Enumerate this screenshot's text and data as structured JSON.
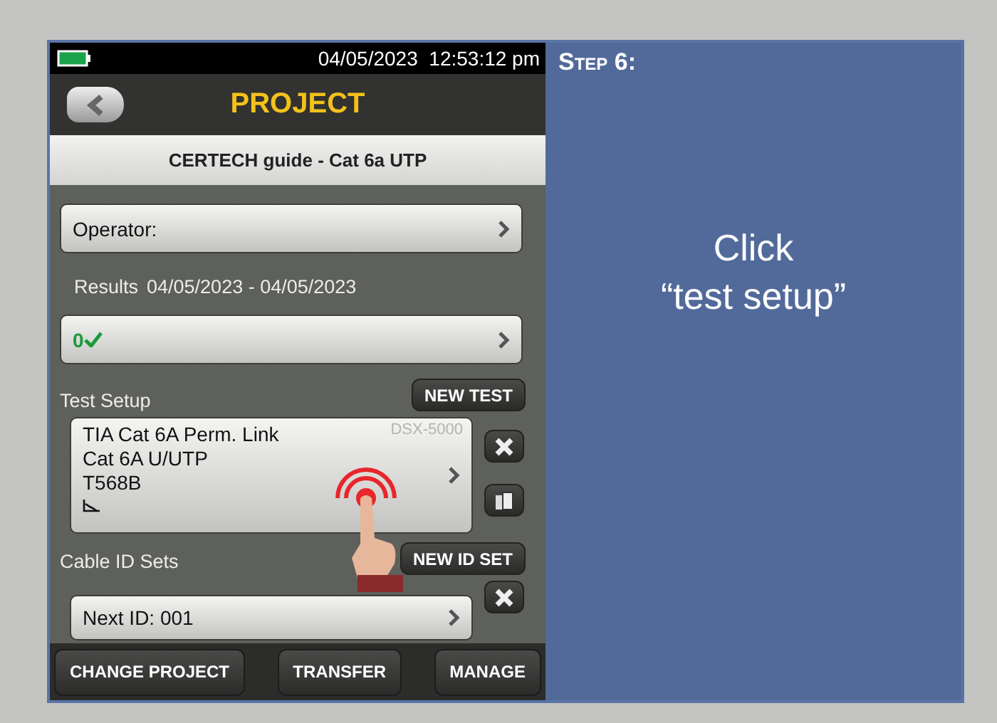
{
  "status_bar": {
    "datetime": "04/05/2023  12:53:12 pm"
  },
  "header": {
    "title": "PROJECT"
  },
  "project_name": "CERTECH guide - Cat 6a UTP",
  "operator": {
    "label": "Operator:"
  },
  "results": {
    "label": "Results",
    "range": "04/05/2023 - 04/05/2023",
    "pass_count": "0"
  },
  "test_setup": {
    "label": "Test Setup",
    "button": "NEW TEST",
    "lines": [
      "TIA Cat 6A Perm. Link",
      "Cat 6A U/UTP",
      "T568B"
    ],
    "device": "DSX-5000"
  },
  "cable_id_sets": {
    "label": "Cable ID Sets",
    "button": "NEW ID SET",
    "next_id": "Next ID: 001"
  },
  "bottom_buttons": [
    "CHANGE PROJECT",
    "TRANSFER",
    "MANAGE"
  ],
  "step": {
    "title": "Step 6:",
    "instruction_lines": [
      "Click",
      "“test setup”"
    ]
  }
}
